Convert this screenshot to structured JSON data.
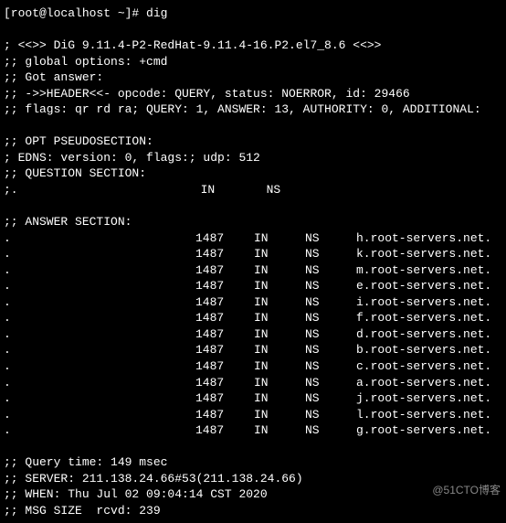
{
  "prompt": "[root@localhost ~]# ",
  "command": "dig",
  "header": {
    "version": "; <<>> DiG 9.11.4-P2-RedHat-9.11.4-16.P2.el7_8.6 <<>>",
    "options": ";; global options: +cmd",
    "got_answer": ";; Got answer:",
    "header_line": ";; ->>HEADER<<- opcode: QUERY, status: NOERROR, id: 29466",
    "flags": ";; flags: qr rd ra; QUERY: 1, ANSWER: 13, AUTHORITY: 0, ADDITIONAL:"
  },
  "opt_title": ";; OPT PSEUDOSECTION:",
  "opt_edns": "; EDNS: version: 0, flags:; udp: 512",
  "question_title": ";; QUESTION SECTION:",
  "question": {
    "dot": ";.",
    "class": "IN",
    "type": "NS"
  },
  "answer_title": ";; ANSWER SECTION:",
  "answers": [
    {
      "dot": ".",
      "ttl": "1487",
      "class": "IN",
      "type": "NS",
      "target": "h.root-servers.net."
    },
    {
      "dot": ".",
      "ttl": "1487",
      "class": "IN",
      "type": "NS",
      "target": "k.root-servers.net."
    },
    {
      "dot": ".",
      "ttl": "1487",
      "class": "IN",
      "type": "NS",
      "target": "m.root-servers.net."
    },
    {
      "dot": ".",
      "ttl": "1487",
      "class": "IN",
      "type": "NS",
      "target": "e.root-servers.net."
    },
    {
      "dot": ".",
      "ttl": "1487",
      "class": "IN",
      "type": "NS",
      "target": "i.root-servers.net."
    },
    {
      "dot": ".",
      "ttl": "1487",
      "class": "IN",
      "type": "NS",
      "target": "f.root-servers.net."
    },
    {
      "dot": ".",
      "ttl": "1487",
      "class": "IN",
      "type": "NS",
      "target": "d.root-servers.net."
    },
    {
      "dot": ".",
      "ttl": "1487",
      "class": "IN",
      "type": "NS",
      "target": "b.root-servers.net."
    },
    {
      "dot": ".",
      "ttl": "1487",
      "class": "IN",
      "type": "NS",
      "target": "c.root-servers.net."
    },
    {
      "dot": ".",
      "ttl": "1487",
      "class": "IN",
      "type": "NS",
      "target": "a.root-servers.net."
    },
    {
      "dot": ".",
      "ttl": "1487",
      "class": "IN",
      "type": "NS",
      "target": "j.root-servers.net."
    },
    {
      "dot": ".",
      "ttl": "1487",
      "class": "IN",
      "type": "NS",
      "target": "l.root-servers.net."
    },
    {
      "dot": ".",
      "ttl": "1487",
      "class": "IN",
      "type": "NS",
      "target": "g.root-servers.net."
    }
  ],
  "footer": {
    "query_time": ";; Query time: 149 msec",
    "server": ";; SERVER: 211.138.24.66#53(211.138.24.66)",
    "when": ";; WHEN: Thu Jul 02 09:04:14 CST 2020",
    "msg_size": ";; MSG SIZE  rcvd: 239"
  },
  "watermark": "@51CTO博客"
}
